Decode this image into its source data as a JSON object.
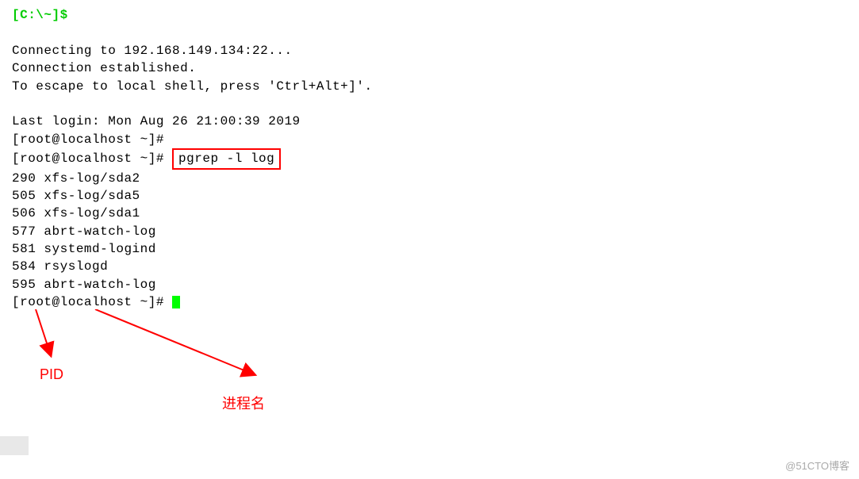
{
  "terminal": {
    "prompt": "[C:\\~]$",
    "lines": {
      "connecting": "Connecting to 192.168.149.134:22...",
      "established": "Connection established.",
      "escape": "To escape to local shell, press 'Ctrl+Alt+]'.",
      "lastlogin": "Last login: Mon Aug 26 21:00:39 2019",
      "rootprompt1": "[root@localhost ~]#",
      "rootprompt2_prefix": "[root@localhost ~]# ",
      "command": "pgrep -l log",
      "rootprompt3_prefix": "[r",
      "rootprompt3_mid": "o",
      "rootprompt3_suffix": "ot@localhost ~]# "
    },
    "output": [
      {
        "pid": "290",
        "name": "xfs-log/sda2"
      },
      {
        "pid": "505",
        "name": "xfs-log/sda5"
      },
      {
        "pid": "506",
        "name": "xfs-log/sda1"
      },
      {
        "pid": "577",
        "name": "abrt-watch-log"
      },
      {
        "pid": "581",
        "name": "systemd-logind"
      },
      {
        "pid": "584",
        "name": "rsyslogd"
      },
      {
        "pid": "595",
        "name": "abrt-watch-log"
      }
    ]
  },
  "annotations": {
    "pid_label": "PID",
    "procname_label": "进程名"
  },
  "watermark": "@51CTO博客"
}
